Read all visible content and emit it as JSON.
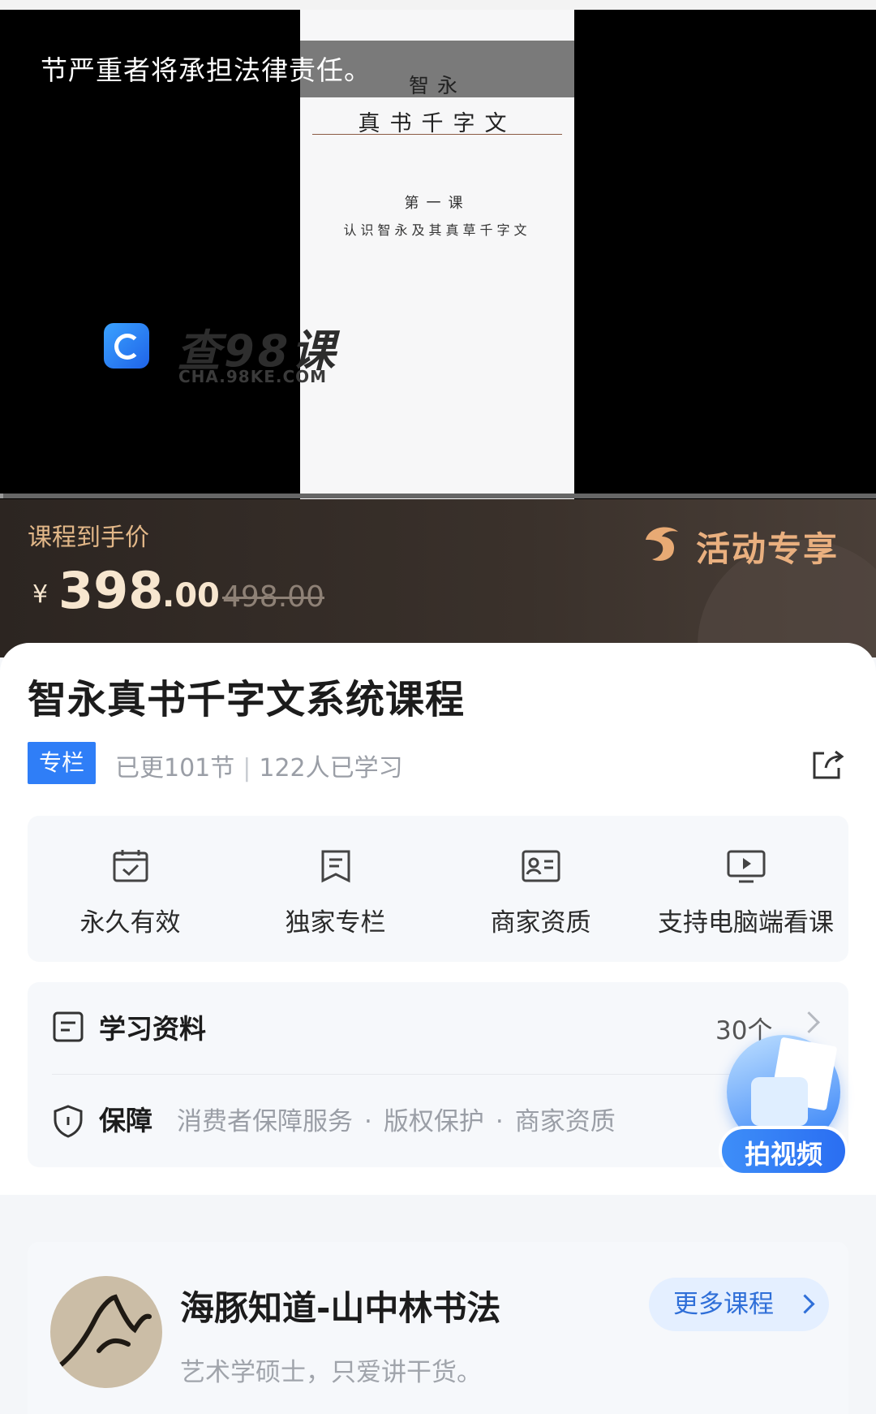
{
  "video": {
    "warning_text": "节严重者将承担法律责任。",
    "slide": {
      "title_line1": "智永",
      "title_line2": "真书千字文",
      "lesson": "第一课",
      "subtitle": "认识智永及其真草千字文"
    },
    "watermark": {
      "text": "查98课",
      "domain": "CHA.98KE.COM"
    },
    "progress_fraction": 0.004
  },
  "price": {
    "label": "课程到手价",
    "currency": "¥",
    "integer": "398",
    "decimal": ".00",
    "original": "498.00",
    "activity": "活动专享"
  },
  "course": {
    "title": "智永真书千字文系统课程",
    "tag": "专栏",
    "updated": "已更101节",
    "learners": "122人已学习"
  },
  "features": [
    {
      "icon": "calendar-check-icon",
      "label": "永久有效"
    },
    {
      "icon": "bookmark-doc-icon",
      "label": "独家专栏"
    },
    {
      "icon": "id-card-icon",
      "label": "商家资质"
    },
    {
      "icon": "monitor-play-icon",
      "label": "支持电脑端看课"
    }
  ],
  "materials": {
    "label": "学习资料",
    "count": "30个"
  },
  "guarantee": {
    "label": "保障",
    "items": [
      "消费者保障服务",
      "版权保护",
      "商家资质"
    ],
    "separator": "·"
  },
  "fab": {
    "label": "拍视频"
  },
  "author": {
    "name": "海豚知道-山中林书法",
    "desc": "艺术学硕士，只爱讲干货。",
    "more_label": "更多课程"
  },
  "colors": {
    "accent": "#2f7ef7",
    "price_gold": "#e2b788",
    "price_bg": "#2c2521"
  }
}
